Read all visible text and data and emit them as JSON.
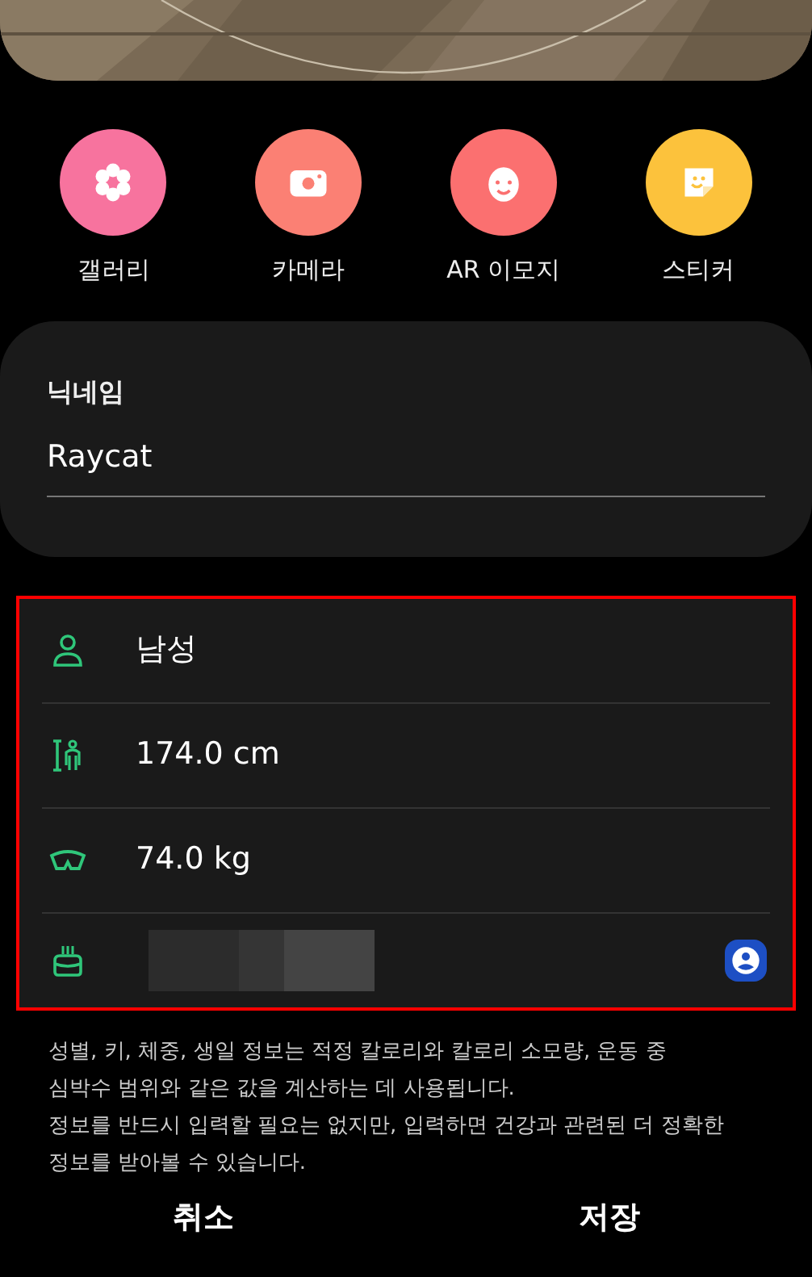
{
  "sources": [
    {
      "label": "갤러리",
      "kind": "gallery",
      "color": "#f7739e"
    },
    {
      "label": "카메라",
      "kind": "camera",
      "color": "#fb8074"
    },
    {
      "label": "AR 이모지",
      "kind": "emoji",
      "color": "#fb7070"
    },
    {
      "label": "스티커",
      "kind": "sticker",
      "color": "#fcc23c"
    }
  ],
  "nickname": {
    "label": "닉네임",
    "value": "Raycat"
  },
  "profile": {
    "highlighted": true,
    "rows": [
      {
        "kind": "gender",
        "value": "남성"
      },
      {
        "kind": "height",
        "value": "174.0 cm"
      },
      {
        "kind": "weight",
        "value": "74.0 kg"
      },
      {
        "kind": "birthday",
        "redacted": true,
        "contact_badge": true
      }
    ]
  },
  "description": [
    "성별, 키, 체중, 생일 정보는 적정 칼로리와 칼로리 소모량, 운동 중 심박수 범위와 같은 값을 계산하는 데 사용됩니다.",
    "정보를 반드시 입력할 필요는 없지만, 입력하면 건강과 관련된 더 정확한 정보를 받아볼 수 있습니다."
  ],
  "buttons": [
    "취소",
    "저장"
  ]
}
